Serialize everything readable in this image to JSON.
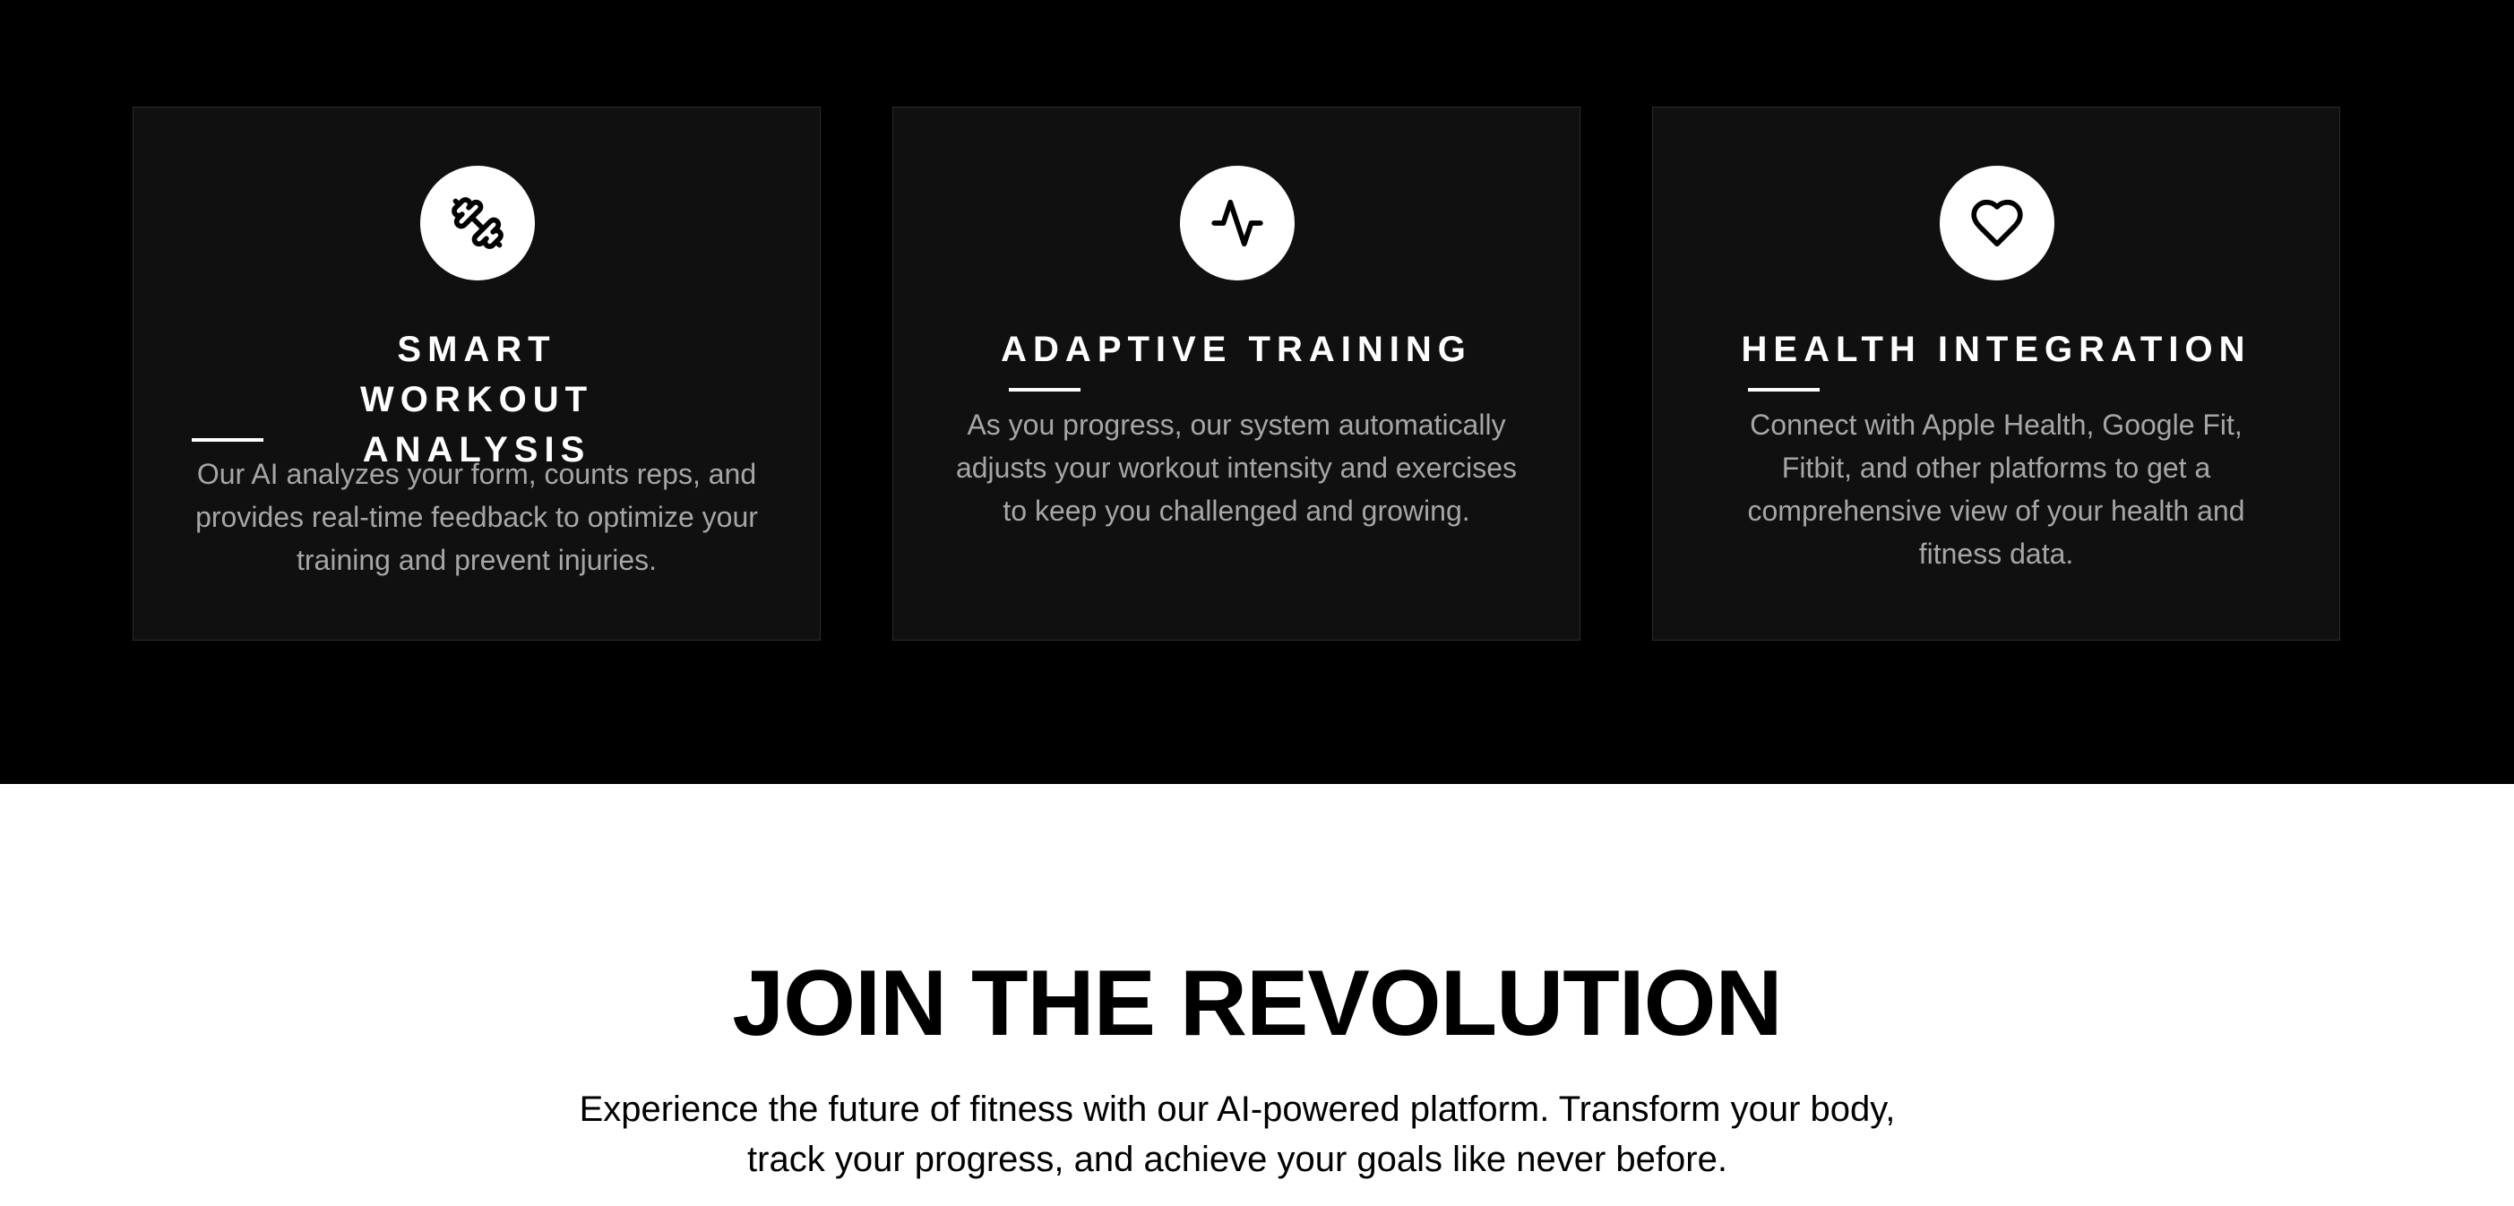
{
  "features": {
    "cards": [
      {
        "icon": "dumbbell-icon",
        "title": "SMART WORKOUT ANALYSIS",
        "description": "Our AI analyzes your form, counts reps, and provides real-time feedback to optimize your training and prevent injuries."
      },
      {
        "icon": "activity-pulse-icon",
        "title": "ADAPTIVE TRAINING",
        "description": "As you progress, our system automatically adjusts your workout intensity and exercises to keep you challenged and growing."
      },
      {
        "icon": "heart-icon",
        "title": "HEALTH INTEGRATION",
        "description": "Connect with Apple Health, Google Fit, Fitbit, and other platforms to get a comprehensive view of your health and fitness data."
      }
    ],
    "colors": {
      "section_background": "#000000",
      "card_background": "#101010",
      "card_border": "#2b2b2b",
      "title": "#ffffff",
      "description": "#a6a6a6",
      "icon_circle": "#ffffff"
    }
  },
  "revolution": {
    "heading": "JOIN THE REVOLUTION",
    "subtext": "Experience the future of fitness with our AI-powered platform. Transform your body, track your progress, and achieve your goals like never before."
  }
}
